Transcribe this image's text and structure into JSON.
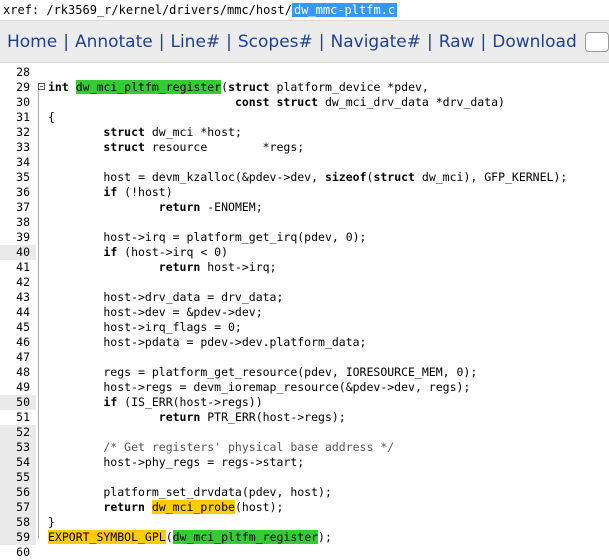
{
  "xref": {
    "prefix": "xref: /rk3569_r/kernel/drivers/mmc/host/",
    "current": "dw_mmc-pltfm.c"
  },
  "nav": {
    "items": [
      {
        "label": "Home"
      },
      {
        "label": "Annotate"
      },
      {
        "label": "Line#"
      },
      {
        "label": "Scopes#"
      },
      {
        "label": "Navigate#"
      },
      {
        "label": "Raw"
      },
      {
        "label": "Download"
      }
    ],
    "separator": "|"
  },
  "code": {
    "lines": [
      {
        "n": "28",
        "t": ""
      },
      {
        "n": "29",
        "t": "int dw_mci_pltfm_register(struct platform_device *pdev,"
      },
      {
        "n": "30",
        "t": "                           const struct dw_mci_drv_data *drv_data)"
      },
      {
        "n": "31",
        "t": "{"
      },
      {
        "n": "32",
        "t": "        struct dw_mci *host;"
      },
      {
        "n": "33",
        "t": "        struct resource        *regs;"
      },
      {
        "n": "34",
        "t": ""
      },
      {
        "n": "35",
        "t": "        host = devm_kzalloc(&pdev->dev, sizeof(struct dw_mci), GFP_KERNEL);"
      },
      {
        "n": "36",
        "t": "        if (!host)"
      },
      {
        "n": "37",
        "t": "                return -ENOMEM;"
      },
      {
        "n": "38",
        "t": ""
      },
      {
        "n": "39",
        "t": "        host->irq = platform_get_irq(pdev, 0);"
      },
      {
        "n": "40",
        "t": "        if (host->irq < 0)"
      },
      {
        "n": "41",
        "t": "                return host->irq;"
      },
      {
        "n": "42",
        "t": ""
      },
      {
        "n": "43",
        "t": "        host->drv_data = drv_data;"
      },
      {
        "n": "44",
        "t": "        host->dev = &pdev->dev;"
      },
      {
        "n": "45",
        "t": "        host->irq_flags = 0;"
      },
      {
        "n": "46",
        "t": "        host->pdata = pdev->dev.platform_data;"
      },
      {
        "n": "47",
        "t": ""
      },
      {
        "n": "48",
        "t": "        regs = platform_get_resource(pdev, IORESOURCE_MEM, 0);"
      },
      {
        "n": "49",
        "t": "        host->regs = devm_ioremap_resource(&pdev->dev, regs);"
      },
      {
        "n": "50",
        "t": "        if (IS_ERR(host->regs))"
      },
      {
        "n": "51",
        "t": "                return PTR_ERR(host->regs);"
      },
      {
        "n": "52",
        "t": ""
      },
      {
        "n": "53",
        "t": "        /* Get registers' physical base address */"
      },
      {
        "n": "54",
        "t": "        host->phy_regs = regs->start;"
      },
      {
        "n": "55",
        "t": ""
      },
      {
        "n": "56",
        "t": "        platform_set_drvdata(pdev, host);"
      },
      {
        "n": "57",
        "t": "        return dw_mci_probe(host);"
      },
      {
        "n": "58",
        "t": "}"
      },
      {
        "n": "59",
        "t": "EXPORT_SYMBOL_GPL(dw_mci_pltfm_register);"
      },
      {
        "n": "60",
        "t": ""
      }
    ]
  },
  "colors": {
    "nav_link": "#1f3f9a",
    "definition_highlight": "#33cc33",
    "symbol_highlight": "#ffcc00",
    "current_file_highlight": "#3399ff"
  }
}
